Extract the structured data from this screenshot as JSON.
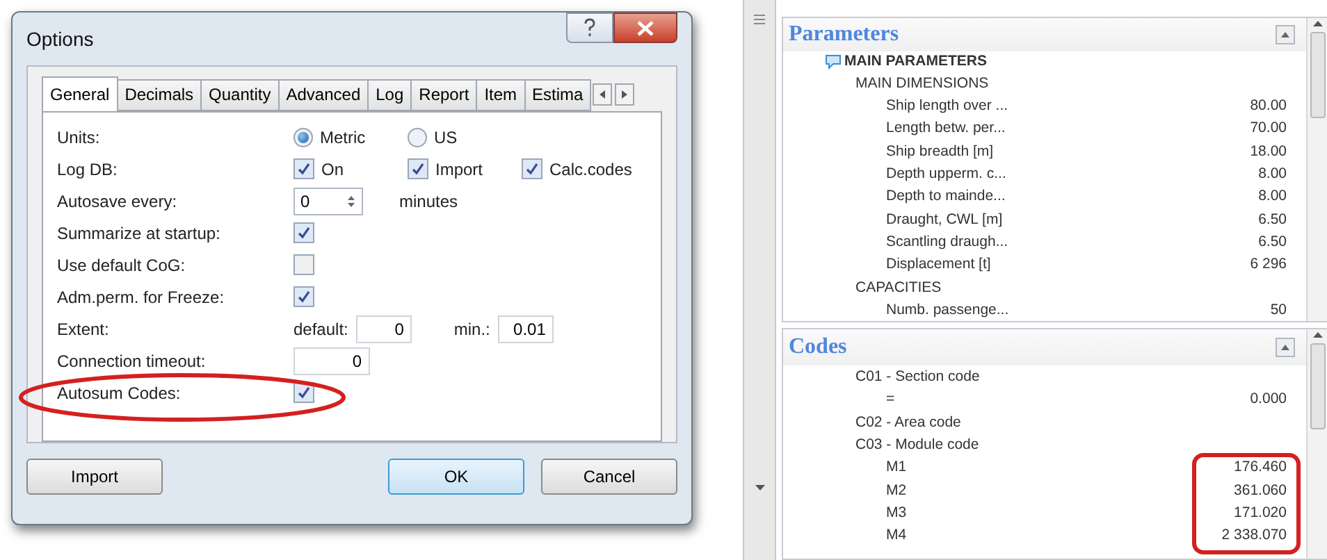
{
  "dialog": {
    "title": "Options",
    "tabs": [
      {
        "label": "General",
        "selected": true
      },
      {
        "label": "Decimals",
        "selected": false
      },
      {
        "label": "Quantity",
        "selected": false
      },
      {
        "label": "Advanced",
        "selected": false
      },
      {
        "label": "Log",
        "selected": false
      },
      {
        "label": "Report",
        "selected": false
      },
      {
        "label": "Item",
        "selected": false
      },
      {
        "label": "Estima",
        "selected": false
      }
    ],
    "rows": [
      {
        "kind": "radio",
        "label": "Units:",
        "options": [
          {
            "label": "Metric",
            "selected": true
          },
          {
            "label": "US",
            "selected": false
          }
        ]
      },
      {
        "kind": "checks",
        "label": "Log DB:",
        "options": [
          {
            "label": "On",
            "checked": true
          },
          {
            "label": "Import",
            "checked": true
          },
          {
            "label": "Calc.codes",
            "checked": true
          }
        ]
      },
      {
        "kind": "spin",
        "label": "Autosave every:",
        "value": "0",
        "unit": "minutes"
      },
      {
        "kind": "check",
        "label": "Summarize at startup:",
        "checked": true
      },
      {
        "kind": "check",
        "label": "Use default CoG:",
        "checked": false
      },
      {
        "kind": "check",
        "label": "Adm.perm. for Freeze:",
        "checked": true
      },
      {
        "kind": "fields",
        "label": "Extent:",
        "fields": [
          {
            "label": "default:",
            "value": "0"
          },
          {
            "label": "min.:",
            "value": "0.01"
          }
        ]
      },
      {
        "kind": "number",
        "label": "Connection timeout:",
        "value": "0"
      },
      {
        "kind": "check",
        "label": "Autosum Codes:",
        "checked": true,
        "circled": true
      }
    ],
    "buttons": [
      {
        "label": "Import",
        "default": false
      },
      {
        "label": "OK",
        "default": true
      },
      {
        "label": "Cancel",
        "default": false
      }
    ]
  },
  "panels": [
    {
      "title": "Parameters",
      "items": [
        {
          "label": "MAIN PARAMETERS",
          "kind": "root",
          "children": [
            {
              "label": "MAIN DIMENSIONS",
              "children": [
                {
                  "label": "Ship length over ...",
                  "value": "80.00"
                },
                {
                  "label": "Length betw. per...",
                  "value": "70.00"
                },
                {
                  "label": "Ship breadth [m]",
                  "value": "18.00"
                },
                {
                  "label": "Depth upperm. c...",
                  "value": "8.00"
                },
                {
                  "label": "Depth to mainde...",
                  "value": "8.00"
                },
                {
                  "label": "Draught, CWL [m]",
                  "value": "6.50"
                },
                {
                  "label": "Scantling draugh...",
                  "value": "6.50"
                },
                {
                  "label": "Displacement [t]",
                  "value": "6 296"
                }
              ]
            },
            {
              "label": "CAPACITIES",
              "children": [
                {
                  "label": "Numb. passenge...",
                  "value": "50"
                }
              ]
            }
          ]
        }
      ]
    },
    {
      "title": "Codes",
      "items": [
        {
          "label": "C01 - Section code",
          "children": [
            {
              "label": "=",
              "value": "0.000"
            }
          ]
        },
        {
          "label": "C02 - Area code"
        },
        {
          "label": "C03 - Module code",
          "boxed": true,
          "children": [
            {
              "label": "M1",
              "value": "176.460"
            },
            {
              "label": "M2",
              "value": "361.060"
            },
            {
              "label": "M3",
              "value": "171.020"
            },
            {
              "label": "M4",
              "value": "2 338.070"
            }
          ]
        }
      ]
    }
  ]
}
